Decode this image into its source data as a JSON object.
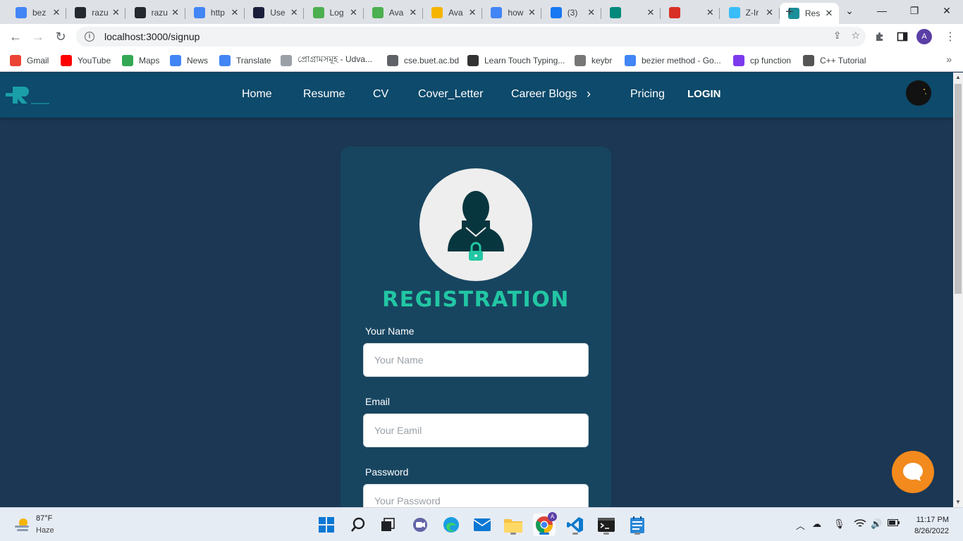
{
  "browser": {
    "tabs": [
      {
        "title": "bez",
        "icon": "google-icon",
        "color": "#4285f4"
      },
      {
        "title": "razu",
        "icon": "github-icon",
        "color": "#24292f"
      },
      {
        "title": "razu",
        "icon": "github-icon",
        "color": "#24292f"
      },
      {
        "title": "http",
        "icon": "google-icon",
        "color": "#4285f4"
      },
      {
        "title": "Use",
        "icon": "vitest-icon",
        "color": "#1b1f3b"
      },
      {
        "title": "Log",
        "icon": "overleaf-icon",
        "color": "#4caf50"
      },
      {
        "title": "Ava",
        "icon": "overleaf-icon",
        "color": "#4caf50"
      },
      {
        "title": "Ava",
        "icon": "sun-icon",
        "color": "#f4b400"
      },
      {
        "title": "how",
        "icon": "google-icon",
        "color": "#4285f4"
      },
      {
        "title": "(3)",
        "icon": "facebook-icon",
        "color": "#1877f2"
      },
      {
        "title": "",
        "icon": "meet-icon",
        "color": "#00897b"
      },
      {
        "title": "",
        "icon": "record-icon",
        "color": "#d93025"
      },
      {
        "title": "Z-Ir",
        "icon": "tailwind-icon",
        "color": "#38bdf8"
      },
      {
        "title": "Res",
        "icon": "resume-logo-icon",
        "color": "#1a8f9a"
      }
    ],
    "url": "localhost:3000/signup",
    "avatar_letter": "A",
    "bookmarks": [
      {
        "label": "Gmail",
        "icon": "gmail-icon",
        "color": "#ea4335"
      },
      {
        "label": "YouTube",
        "icon": "youtube-icon",
        "color": "#ff0000"
      },
      {
        "label": "Maps",
        "icon": "maps-icon",
        "color": "#34a853"
      },
      {
        "label": "News",
        "icon": "news-icon",
        "color": "#4285f4"
      },
      {
        "label": "Translate",
        "icon": "translate-icon",
        "color": "#4285f4"
      },
      {
        "label": "প্রোগ্রামসমূহ - Udva...",
        "icon": "document-icon",
        "color": "#9aa0a6"
      },
      {
        "label": "cse.buet.ac.bd",
        "icon": "globe-icon",
        "color": "#5f6368"
      },
      {
        "label": "Learn Touch Typing...",
        "icon": "typing-icon",
        "color": "#333333"
      },
      {
        "label": "keybr",
        "icon": "keybr-icon",
        "color": "#777777"
      },
      {
        "label": "bezier method - Go...",
        "icon": "google-icon",
        "color": "#4285f4"
      },
      {
        "label": "cp function",
        "icon": "cp-icon",
        "color": "#7c3aed"
      },
      {
        "label": "C++ Tutorial",
        "icon": "cpp-icon",
        "color": "#555555"
      }
    ]
  },
  "site": {
    "nav": {
      "home": "Home",
      "resume": "Resume",
      "cv": "CV",
      "cover_letter": "Cover_Letter",
      "career_blogs": "Career Blogs",
      "pricing": "Pricing",
      "login": "LOGIN"
    },
    "colors": {
      "header": "#0d4a6b",
      "page": "#1b3754",
      "card": "#174560",
      "accent": "#22c6a3",
      "chat": "#f28a1d"
    }
  },
  "form": {
    "title": "REGISTRATION",
    "name_label": "Your Name",
    "name_placeholder": "Your Name",
    "email_label": "Email",
    "email_placeholder": "Your Eamil",
    "password_label": "Password",
    "password_placeholder": "Your Password"
  },
  "taskbar": {
    "weather_temp": "87°F",
    "weather_desc": "Haze",
    "time": "11:17 PM",
    "date": "8/26/2022"
  }
}
